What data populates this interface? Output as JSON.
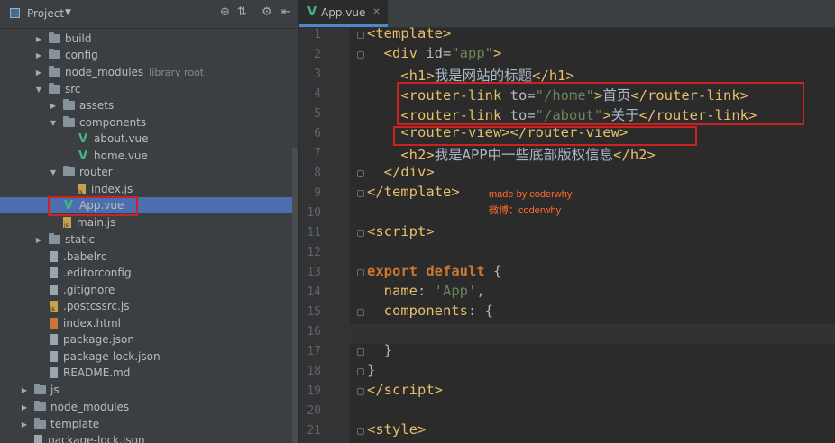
{
  "sidebar": {
    "title": "Project",
    "tree": [
      {
        "label": "build",
        "type": "folder"
      },
      {
        "label": "config",
        "type": "folder"
      },
      {
        "label": "node_modules",
        "type": "folder",
        "hint": "library root"
      },
      {
        "label": "src",
        "type": "folder"
      },
      {
        "label": "assets",
        "type": "folder"
      },
      {
        "label": "components",
        "type": "folder"
      },
      {
        "label": "about.vue",
        "type": "vue"
      },
      {
        "label": "home.vue",
        "type": "vue"
      },
      {
        "label": "router",
        "type": "folder"
      },
      {
        "label": "index.js",
        "type": "js"
      },
      {
        "label": "App.vue",
        "type": "vue"
      },
      {
        "label": "main.js",
        "type": "js"
      },
      {
        "label": "static",
        "type": "folder"
      },
      {
        "label": ".babelrc",
        "type": "file"
      },
      {
        "label": ".editorconfig",
        "type": "file"
      },
      {
        "label": ".gitignore",
        "type": "file"
      },
      {
        "label": ".postcssrc.js",
        "type": "js"
      },
      {
        "label": "index.html",
        "type": "html"
      },
      {
        "label": "package.json",
        "type": "json"
      },
      {
        "label": "package-lock.json",
        "type": "json"
      },
      {
        "label": "README.md",
        "type": "md"
      },
      {
        "label": "js",
        "type": "folder"
      },
      {
        "label": "node_modules",
        "type": "folder"
      },
      {
        "label": "template",
        "type": "folder"
      },
      {
        "label": "package-lock.json",
        "type": "json"
      }
    ]
  },
  "editor": {
    "tab_label": "App.vue",
    "line_numbers": [
      "1",
      "2",
      "3",
      "4",
      "5",
      "6",
      "7",
      "8",
      "9",
      "10",
      "11",
      "12",
      "13",
      "14",
      "15",
      "16",
      "17",
      "18",
      "19",
      "20",
      "21"
    ],
    "line2_attr": "id=",
    "line2_value": "\"app\"",
    "line3_text": "我是网站的标题",
    "line4_attr": "to=",
    "line4_value": "\"/home\"",
    "line4_text": "首页",
    "line5_attr": "to=",
    "line5_value": "\"/about\"",
    "line5_text": "关于",
    "line7_text": "我是APP中一些底部版权信息",
    "line14_key": "name",
    "line14_value": "'App'",
    "line15_key": "components"
  },
  "watermark": {
    "line1": "made by coderwhy",
    "line2": "微博：coderwhy"
  },
  "colors": {
    "accent": "#4b6eaf",
    "highlight_box": "#cc2222",
    "vue_green": "#41b883"
  }
}
